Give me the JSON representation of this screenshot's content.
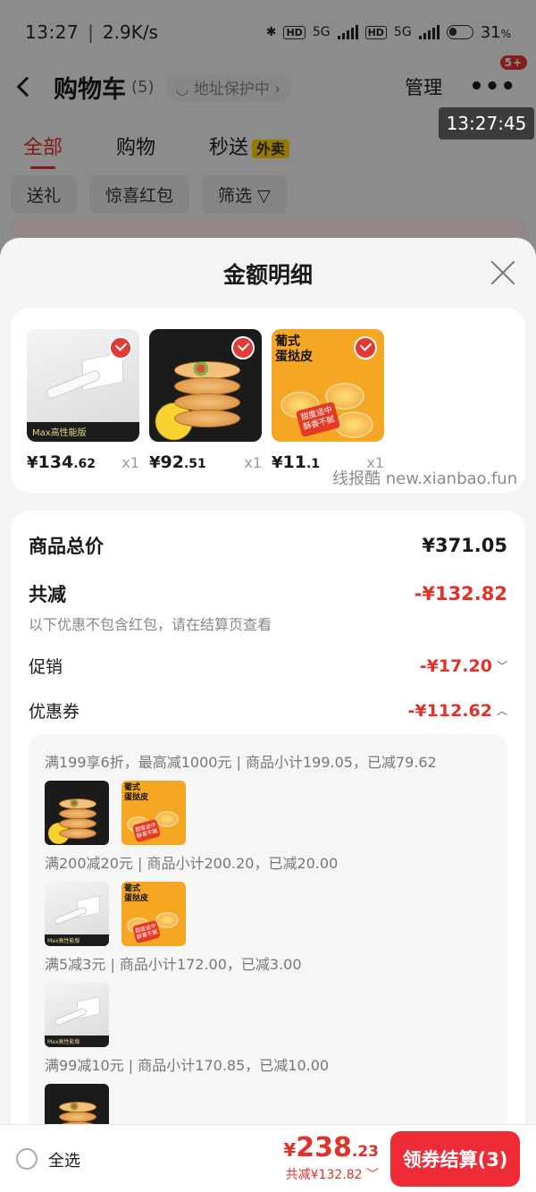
{
  "status_bar": {
    "time": "13:27",
    "net_speed": "2.9K/s",
    "hd1": "HD",
    "net1": "5G",
    "hd2": "HD",
    "net2": "5G",
    "battery": "31",
    "battery_unit": "%"
  },
  "nav": {
    "title": "购物车",
    "count": "(5)",
    "address_protect": "地址保护中",
    "manage": "管理",
    "more_badge": "5+"
  },
  "floating_clock": "13:27:45",
  "tabs": {
    "all": "全部",
    "shopping": "购物",
    "instant": "秒送",
    "takeout": "外卖"
  },
  "chips": {
    "gift": "送礼",
    "red_packet": "惊喜红包",
    "filter": "筛选"
  },
  "sheet": {
    "title": "金额明细",
    "watermark": "线报酷 new.xianbao.fun",
    "products": [
      {
        "yen": "¥",
        "price_int": "134",
        "price_dec": ".62",
        "qty": "x1",
        "thumb_text": "Max高性能版"
      },
      {
        "yen": "¥",
        "price_int": "92",
        "price_dec": ".51",
        "qty": "x1"
      },
      {
        "yen": "¥",
        "price_int": "11",
        "price_dec": ".1",
        "qty": "x1",
        "thumb_title": "葡式\n蛋挞皮",
        "thumb_badge": "甜度适中\n酥香不腻"
      }
    ],
    "summary": {
      "total_label": "商品总价",
      "total_value": "¥371.05",
      "reduce_label": "共减",
      "reduce_value": "-¥132.82",
      "reduce_note": "以下优惠不包含红包，请在结算页查看",
      "promo_label": "促销",
      "promo_value": "-¥17.20",
      "coupon_label": "优惠券",
      "coupon_value": "-¥112.62"
    },
    "coupons": [
      "满199享6折，最高减1000元 | 商品小计199.05，已减79.62",
      "满200减20元 | 商品小计200.20，已减20.00",
      "满5减3元 | 商品小计172.00，已减3.00",
      "满99减10元 | 商品小计170.85，已减10.00"
    ]
  },
  "bottom_bar": {
    "select_all": "全选",
    "total_yen": "¥",
    "total_int": "238",
    "total_dec": ".23",
    "saved": "共减¥132.82",
    "checkout": "领券结算(3)"
  },
  "colors": {
    "accent_red": "#e0322a",
    "checkout_red": "#ef2b36",
    "takeout_yellow": "#ffd400"
  }
}
